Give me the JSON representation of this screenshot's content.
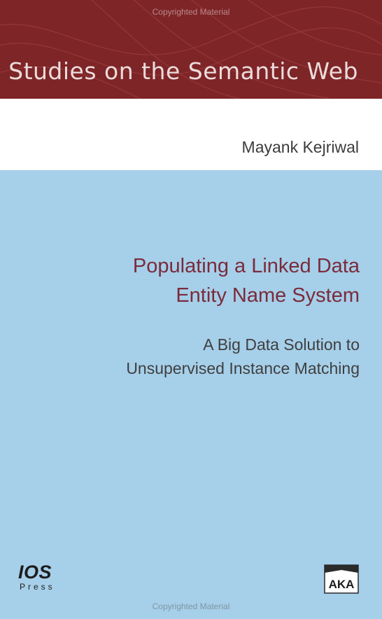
{
  "cover": {
    "series": "Studies on the Semantic Web",
    "author": "Mayank Kejriwal",
    "title_line1": "Populating a Linked Data",
    "title_line2": "Entity Name System",
    "subtitle_line1": "A Big Data Solution to",
    "subtitle_line2": "Unsupervised Instance Matching",
    "watermark": "Copyrighted Material",
    "publisher": {
      "name": "IOS",
      "sub": "Press",
      "logo_icon": "ios-press-logo"
    },
    "imprint": {
      "text": "AKA",
      "logo_icon": "aka-logo"
    }
  },
  "colors": {
    "series_band": "#7e2527",
    "author_band": "#ffffff",
    "main": "#a6cfe9",
    "title_text": "#7a2c3c"
  }
}
